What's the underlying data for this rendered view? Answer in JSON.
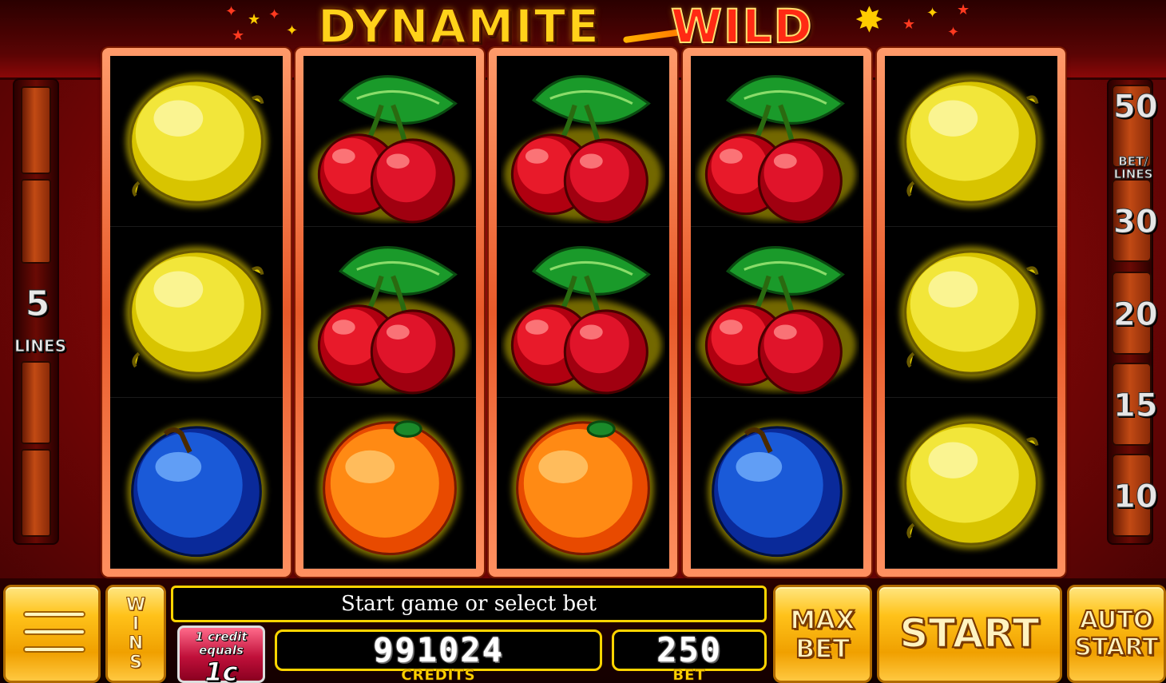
{
  "title": {
    "word1": "DYNAMITE",
    "word2": "WILD"
  },
  "left_panel": {
    "lines_value": "5",
    "lines_label": "LINES"
  },
  "right_panel": {
    "bet_label": "BET/ LINES",
    "options": [
      "50",
      "30",
      "20",
      "15",
      "10"
    ]
  },
  "reels": [
    [
      "lemon",
      "lemon",
      "plum"
    ],
    [
      "cherry",
      "cherry",
      "orange"
    ],
    [
      "cherry",
      "cherry",
      "orange"
    ],
    [
      "cherry",
      "cherry",
      "plum"
    ],
    [
      "lemon",
      "lemon",
      "lemon"
    ]
  ],
  "icons": {
    "menu": "hamburger-menu-icon"
  },
  "wins_button": {
    "letters": [
      "W",
      "I",
      "N",
      "S"
    ]
  },
  "message": "Start game or select bet",
  "denomination": {
    "line": "1 credit equals",
    "value": "1c"
  },
  "credits": {
    "value": "991024",
    "label": "CREDITS"
  },
  "bet": {
    "value": "250",
    "label": "BET"
  },
  "buttons": {
    "max_bet_line1": "MAX",
    "max_bet_line2": "BET",
    "start": "START",
    "auto_start_line1": "AUTO",
    "auto_start_line2": "START"
  },
  "colors": {
    "gold": "#ffd400",
    "background_red": "#8a0808",
    "reel_frame": "#e85a2a"
  }
}
